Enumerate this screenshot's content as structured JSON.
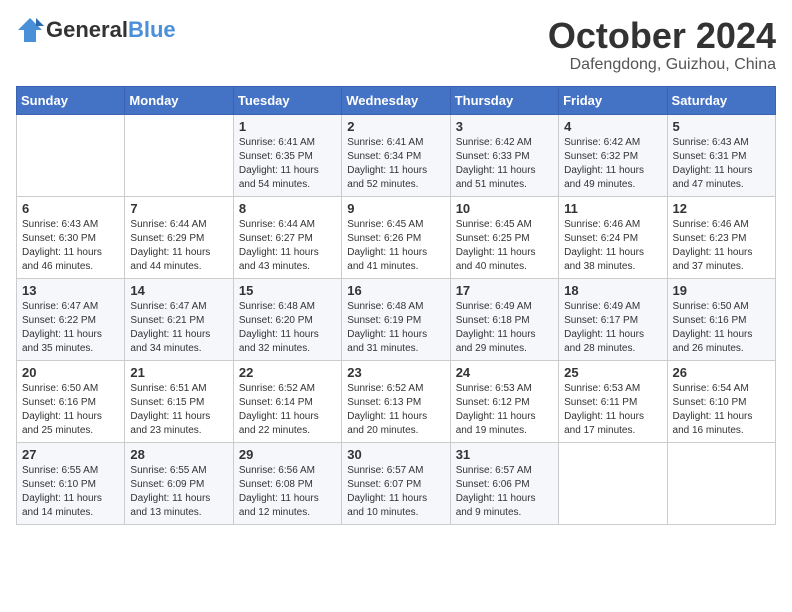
{
  "header": {
    "logo_general": "General",
    "logo_blue": "Blue",
    "month_title": "October 2024",
    "location": "Dafengdong, Guizhou, China"
  },
  "days_of_week": [
    "Sunday",
    "Monday",
    "Tuesday",
    "Wednesday",
    "Thursday",
    "Friday",
    "Saturday"
  ],
  "weeks": [
    [
      {
        "day": "",
        "content": ""
      },
      {
        "day": "",
        "content": ""
      },
      {
        "day": "1",
        "content": "Sunrise: 6:41 AM\nSunset: 6:35 PM\nDaylight: 11 hours and 54 minutes."
      },
      {
        "day": "2",
        "content": "Sunrise: 6:41 AM\nSunset: 6:34 PM\nDaylight: 11 hours and 52 minutes."
      },
      {
        "day": "3",
        "content": "Sunrise: 6:42 AM\nSunset: 6:33 PM\nDaylight: 11 hours and 51 minutes."
      },
      {
        "day": "4",
        "content": "Sunrise: 6:42 AM\nSunset: 6:32 PM\nDaylight: 11 hours and 49 minutes."
      },
      {
        "day": "5",
        "content": "Sunrise: 6:43 AM\nSunset: 6:31 PM\nDaylight: 11 hours and 47 minutes."
      }
    ],
    [
      {
        "day": "6",
        "content": "Sunrise: 6:43 AM\nSunset: 6:30 PM\nDaylight: 11 hours and 46 minutes."
      },
      {
        "day": "7",
        "content": "Sunrise: 6:44 AM\nSunset: 6:29 PM\nDaylight: 11 hours and 44 minutes."
      },
      {
        "day": "8",
        "content": "Sunrise: 6:44 AM\nSunset: 6:27 PM\nDaylight: 11 hours and 43 minutes."
      },
      {
        "day": "9",
        "content": "Sunrise: 6:45 AM\nSunset: 6:26 PM\nDaylight: 11 hours and 41 minutes."
      },
      {
        "day": "10",
        "content": "Sunrise: 6:45 AM\nSunset: 6:25 PM\nDaylight: 11 hours and 40 minutes."
      },
      {
        "day": "11",
        "content": "Sunrise: 6:46 AM\nSunset: 6:24 PM\nDaylight: 11 hours and 38 minutes."
      },
      {
        "day": "12",
        "content": "Sunrise: 6:46 AM\nSunset: 6:23 PM\nDaylight: 11 hours and 37 minutes."
      }
    ],
    [
      {
        "day": "13",
        "content": "Sunrise: 6:47 AM\nSunset: 6:22 PM\nDaylight: 11 hours and 35 minutes."
      },
      {
        "day": "14",
        "content": "Sunrise: 6:47 AM\nSunset: 6:21 PM\nDaylight: 11 hours and 34 minutes."
      },
      {
        "day": "15",
        "content": "Sunrise: 6:48 AM\nSunset: 6:20 PM\nDaylight: 11 hours and 32 minutes."
      },
      {
        "day": "16",
        "content": "Sunrise: 6:48 AM\nSunset: 6:19 PM\nDaylight: 11 hours and 31 minutes."
      },
      {
        "day": "17",
        "content": "Sunrise: 6:49 AM\nSunset: 6:18 PM\nDaylight: 11 hours and 29 minutes."
      },
      {
        "day": "18",
        "content": "Sunrise: 6:49 AM\nSunset: 6:17 PM\nDaylight: 11 hours and 28 minutes."
      },
      {
        "day": "19",
        "content": "Sunrise: 6:50 AM\nSunset: 6:16 PM\nDaylight: 11 hours and 26 minutes."
      }
    ],
    [
      {
        "day": "20",
        "content": "Sunrise: 6:50 AM\nSunset: 6:16 PM\nDaylight: 11 hours and 25 minutes."
      },
      {
        "day": "21",
        "content": "Sunrise: 6:51 AM\nSunset: 6:15 PM\nDaylight: 11 hours and 23 minutes."
      },
      {
        "day": "22",
        "content": "Sunrise: 6:52 AM\nSunset: 6:14 PM\nDaylight: 11 hours and 22 minutes."
      },
      {
        "day": "23",
        "content": "Sunrise: 6:52 AM\nSunset: 6:13 PM\nDaylight: 11 hours and 20 minutes."
      },
      {
        "day": "24",
        "content": "Sunrise: 6:53 AM\nSunset: 6:12 PM\nDaylight: 11 hours and 19 minutes."
      },
      {
        "day": "25",
        "content": "Sunrise: 6:53 AM\nSunset: 6:11 PM\nDaylight: 11 hours and 17 minutes."
      },
      {
        "day": "26",
        "content": "Sunrise: 6:54 AM\nSunset: 6:10 PM\nDaylight: 11 hours and 16 minutes."
      }
    ],
    [
      {
        "day": "27",
        "content": "Sunrise: 6:55 AM\nSunset: 6:10 PM\nDaylight: 11 hours and 14 minutes."
      },
      {
        "day": "28",
        "content": "Sunrise: 6:55 AM\nSunset: 6:09 PM\nDaylight: 11 hours and 13 minutes."
      },
      {
        "day": "29",
        "content": "Sunrise: 6:56 AM\nSunset: 6:08 PM\nDaylight: 11 hours and 12 minutes."
      },
      {
        "day": "30",
        "content": "Sunrise: 6:57 AM\nSunset: 6:07 PM\nDaylight: 11 hours and 10 minutes."
      },
      {
        "day": "31",
        "content": "Sunrise: 6:57 AM\nSunset: 6:06 PM\nDaylight: 11 hours and 9 minutes."
      },
      {
        "day": "",
        "content": ""
      },
      {
        "day": "",
        "content": ""
      }
    ]
  ]
}
